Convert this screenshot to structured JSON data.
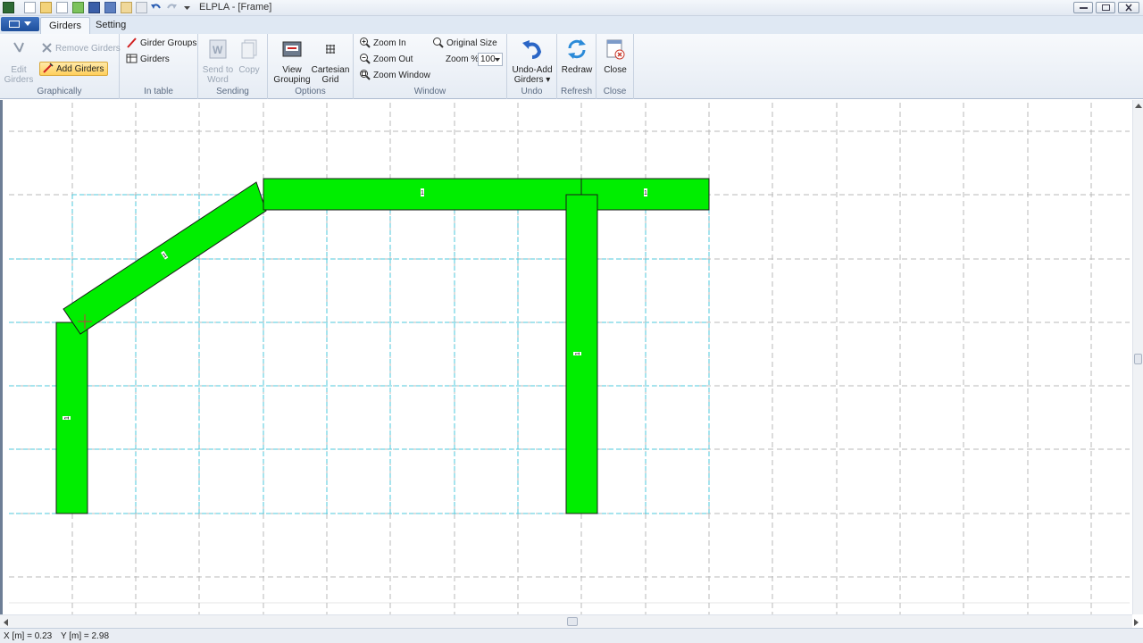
{
  "window": {
    "title": "ELPLA - [Frame]"
  },
  "tabs": {
    "girders": "Girders",
    "setting": "Setting"
  },
  "ribbon": {
    "graphically": {
      "label": "Graphically",
      "edit_girders_1": "Edit",
      "edit_girders_2": "Girders",
      "remove_girders": "Remove Girders",
      "add_girders": "Add Girders"
    },
    "in_table": {
      "label": "In table",
      "girder_groups": "Girder Groups",
      "girders": "Girders"
    },
    "sending": {
      "label": "Sending",
      "send_to_word_1": "Send to",
      "send_to_word_2": "Word",
      "copy": "Copy"
    },
    "options": {
      "label": "Options",
      "view_grouping_1": "View",
      "view_grouping_2": "Grouping",
      "cartesian_grid_1": "Cartesian",
      "cartesian_grid_2": "Grid"
    },
    "window": {
      "label": "Window",
      "zoom_in": "Zoom In",
      "zoom_out": "Zoom Out",
      "zoom_window": "Zoom Window",
      "original_size": "Original Size",
      "zoom_pct_label": "Zoom %",
      "zoom_value": "100"
    },
    "undo": {
      "label": "Undo",
      "undo_add_1": "Undo-Add",
      "undo_add_2": "Girders"
    },
    "refresh": {
      "label": "Refresh",
      "redraw": "Redraw"
    },
    "close": {
      "label": "Close",
      "close_btn": "Close"
    }
  },
  "girders": {
    "left_column": "1",
    "inclined": "1",
    "top_beam": "1",
    "right_beam": "1",
    "right_column": "1"
  },
  "status": {
    "x": "X [m] = 0.23",
    "y": "Y [m] = 2.98"
  },
  "colors": {
    "girder_fill": "#00ee00",
    "grid_cyan": "#4dc8dc",
    "grid_gray": "#b8b8b8"
  }
}
